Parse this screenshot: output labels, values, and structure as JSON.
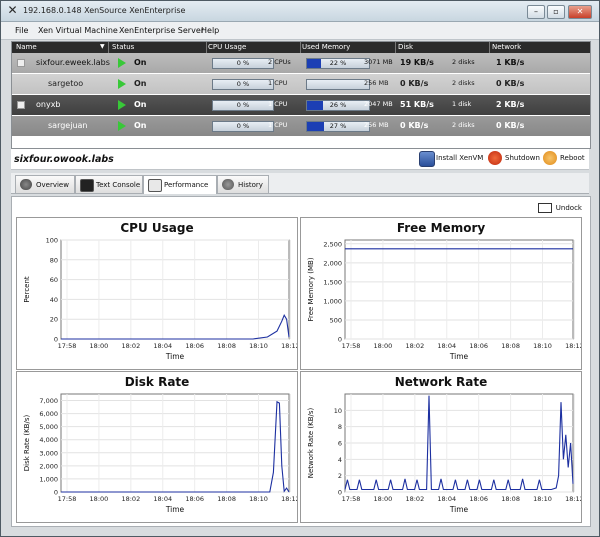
{
  "window": {
    "title": "192.168.0.148 XenSource XenEnterprise",
    "controls": {
      "minimize": "–",
      "maximize": "▫",
      "close": "✕"
    }
  },
  "menu": [
    "File",
    "Xen Virtual Machine",
    "XenEnterprise Server",
    "Help"
  ],
  "grid": {
    "columns": [
      "Name",
      "Status",
      "CPU Usage",
      "Used Memory",
      "Disk",
      "Network"
    ],
    "rows": [
      {
        "kind": "host",
        "name": "sixfour.eweek.labs",
        "status": "On",
        "cpu_pct": 0,
        "cpu_label": "0 %",
        "cpu_count": "2 CPUs",
        "mem_pct": 22,
        "mem_label": "22 %",
        "mem_total": "3071 MB",
        "disk_rate": "19 KB/s",
        "disk_count": "2 disks",
        "network": "1 KB/s"
      },
      {
        "kind": "vm",
        "name": "sargetoo",
        "status": "On",
        "cpu_pct": 0,
        "cpu_label": "0 %",
        "cpu_count": "1 CPU",
        "mem_pct": 0,
        "mem_label": "",
        "mem_total": "256 MB",
        "disk_rate": "0 KB/s",
        "disk_count": "2 disks",
        "network": "0 KB/s"
      },
      {
        "kind": "host",
        "name": "onyxb",
        "status": "On",
        "cpu_pct": 0,
        "cpu_label": "0 %",
        "cpu_count": "1 CPU",
        "mem_pct": 26,
        "mem_label": "26 %",
        "mem_total": "2047 MB",
        "disk_rate": "51 KB/s",
        "disk_count": "1 disk",
        "network": "2 KB/s"
      },
      {
        "kind": "vm",
        "name": "sargejuan",
        "status": "On",
        "cpu_pct": 0,
        "cpu_label": "0 %",
        "cpu_count": "1 CPU",
        "mem_pct": 27,
        "mem_label": "27 %",
        "mem_total": "256 MB",
        "disk_rate": "0 KB/s",
        "disk_count": "2 disks",
        "network": "0 KB/s"
      }
    ]
  },
  "toolbar": {
    "selected_host": "sixfour.owook.labs",
    "install": "Install XenVM",
    "shutdown": "Shutdown",
    "reboot": "Reboot"
  },
  "tabs": [
    "Overview",
    "Text Console",
    "Performance",
    "History"
  ],
  "active_tab": "Performance",
  "undock": "Undock",
  "charts": [
    {
      "title": "CPU Usage",
      "ylabel": "Percent",
      "xlabel": "Time",
      "yticks": [
        "100",
        "80",
        "60",
        "40",
        "20",
        "0"
      ],
      "xticks": [
        "17:58",
        "18:00",
        "18:02",
        "18:04",
        "18:06",
        "18:08",
        "18:10",
        "18:12"
      ]
    },
    {
      "title": "Free Memory",
      "ylabel": "Free Memory (MB)",
      "xlabel": "Time",
      "yticks": [
        "2,500",
        "2,000",
        "1,500",
        "1,000",
        "500",
        "0"
      ],
      "xticks": [
        "17:58",
        "18:00",
        "18:02",
        "18:04",
        "18:06",
        "18:08",
        "18:10",
        "18:12"
      ]
    },
    {
      "title": "Disk Rate",
      "ylabel": "Disk Rate (KB/s)",
      "xlabel": "Time",
      "yticks": [
        "7,000",
        "6,000",
        "5,000",
        "4,000",
        "3,000",
        "2,000",
        "1,000",
        "0"
      ],
      "xticks": [
        "17:58",
        "18:00",
        "18:02",
        "18:04",
        "18:06",
        "18:08",
        "18:10",
        "18:12"
      ]
    },
    {
      "title": "Network Rate",
      "ylabel": "Network Rate (KB/s)",
      "xlabel": "Time",
      "yticks": [
        "10",
        "8",
        "6",
        "4",
        "2",
        "0"
      ],
      "xticks": [
        "17:58",
        "18:00",
        "18:02",
        "18:04",
        "18:06",
        "18:08",
        "18:10",
        "18:12"
      ]
    }
  ],
  "chart_data": [
    {
      "type": "line",
      "title": "CPU Usage",
      "xlabel": "Time",
      "ylabel": "Percent",
      "ylim": [
        0,
        100
      ],
      "x": [
        0,
        1,
        2,
        3,
        4,
        5,
        6,
        7,
        8,
        8.6,
        9,
        9.2,
        9.3,
        9.4,
        9.5
      ],
      "series": [
        {
          "values": [
            0,
            0,
            0,
            0,
            0,
            0,
            0,
            0,
            0,
            2,
            8,
            18,
            24,
            20,
            2
          ]
        }
      ]
    },
    {
      "type": "line",
      "title": "Free Memory",
      "xlabel": "Time",
      "ylabel": "Free Memory (MB)",
      "ylim": [
        0,
        2600
      ],
      "x": [
        0,
        9.5
      ],
      "series": [
        {
          "values": [
            2370,
            2370
          ]
        }
      ]
    },
    {
      "type": "line",
      "title": "Disk Rate",
      "xlabel": "Time",
      "ylabel": "Disk Rate (KB/s)",
      "ylim": [
        0,
        7500
      ],
      "x": [
        0,
        1,
        2,
        3,
        4,
        5,
        6,
        7,
        8,
        8.7,
        8.85,
        9,
        9.1,
        9.2,
        9.3,
        9.4,
        9.5
      ],
      "series": [
        {
          "values": [
            0,
            0,
            0,
            0,
            0,
            0,
            0,
            0,
            0,
            0,
            1500,
            6900,
            6800,
            2000,
            50,
            300,
            0
          ]
        }
      ]
    },
    {
      "type": "line",
      "title": "Network Rate",
      "xlabel": "Time",
      "ylabel": "Network Rate (KB/s)",
      "ylim": [
        0,
        12
      ],
      "x": [
        0,
        0.1,
        0.2,
        0.5,
        0.6,
        0.7,
        1.2,
        1.3,
        1.4,
        1.8,
        1.9,
        2.0,
        2.4,
        2.5,
        2.6,
        2.9,
        3.0,
        3.1,
        3.4,
        3.5,
        3.6,
        3.9,
        4.0,
        4.1,
        4.5,
        4.6,
        4.7,
        5.0,
        5.1,
        5.2,
        5.5,
        5.6,
        5.7,
        6.1,
        6.2,
        6.3,
        6.7,
        6.8,
        6.9,
        7.3,
        7.4,
        7.5,
        8.0,
        8.1,
        8.2,
        8.6,
        8.8,
        8.9,
        9.0,
        9.1,
        9.2,
        9.3,
        9.4,
        9.5
      ],
      "series": [
        {
          "values": [
            0.3,
            1.5,
            0.3,
            0.3,
            1.5,
            0.3,
            0.3,
            1.5,
            0.3,
            0.3,
            1.5,
            0.3,
            0.3,
            1.6,
            0.3,
            0.3,
            1.5,
            0.3,
            0.3,
            11.8,
            0.3,
            0.3,
            1.6,
            0.3,
            0.3,
            1.5,
            0.3,
            0.3,
            1.5,
            0.3,
            0.3,
            1.5,
            0.3,
            0.3,
            1.5,
            0.3,
            0.3,
            1.5,
            0.3,
            0.3,
            1.6,
            0.3,
            0.3,
            1.5,
            0.3,
            0.3,
            0.5,
            2,
            11,
            4,
            7,
            3,
            6,
            1
          ]
        }
      ]
    }
  ]
}
